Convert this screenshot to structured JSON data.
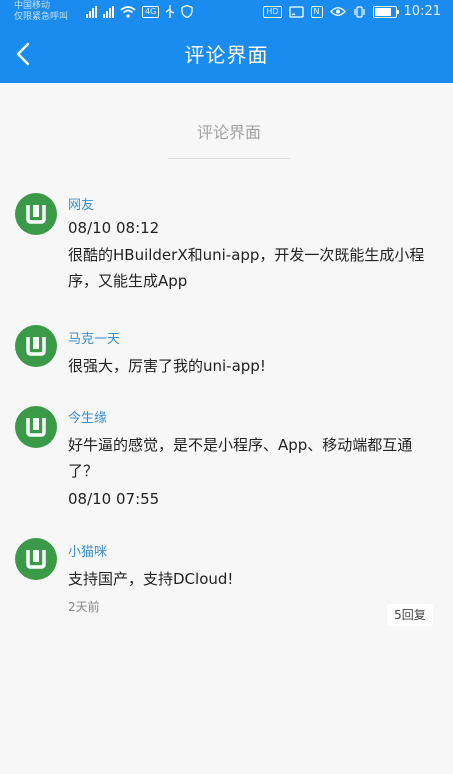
{
  "status_bar": {
    "carrier_line1": "中国移动",
    "carrier_line2": "仅限紧急呼叫",
    "network": "4G",
    "nfc_badge": "N",
    "hd_badge": "HD",
    "time": "10:21"
  },
  "nav": {
    "title": "评论界面"
  },
  "section": {
    "title": "评论界面"
  },
  "comments": [
    {
      "name": "网友",
      "time": "08/10 08:12",
      "text": "很酷的HBuilderX和uni-app，开发一次既能生成小程序，又能生成App"
    },
    {
      "name": "马克一天",
      "text": "很强大，厉害了我的uni-app!"
    },
    {
      "name": "今生缘",
      "text": "好牛逼的感觉，是不是小程序、App、移动端都互通了？",
      "time": "08/10 07:55"
    },
    {
      "name": "小猫咪",
      "text": "支持国产，支持DCloud!",
      "date": "2天前",
      "reply": "5回复"
    }
  ],
  "colors": {
    "header": "#1a8cf0",
    "avatar": "#3b9a48",
    "name": "#3a8fd1"
  }
}
